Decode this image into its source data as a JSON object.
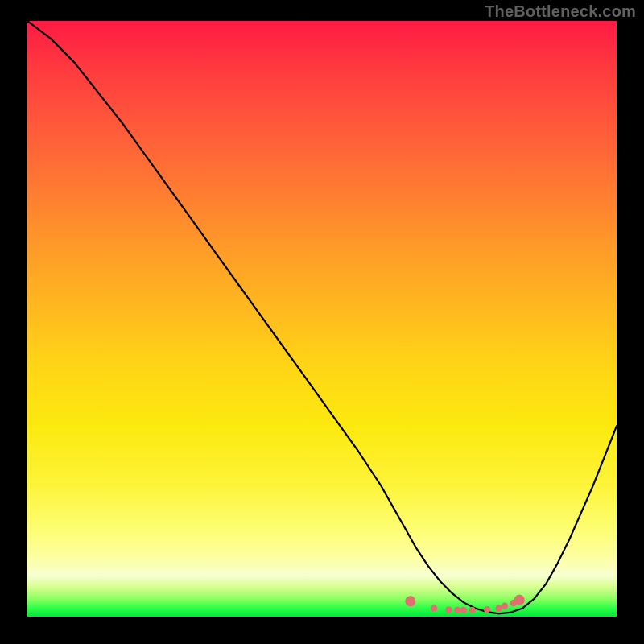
{
  "watermark": "TheBottleneck.com",
  "chart_data": {
    "type": "line",
    "title": "",
    "xlabel": "",
    "ylabel": "",
    "xlim": [
      0,
      100
    ],
    "ylim": [
      0,
      100
    ],
    "series": [
      {
        "name": "bottleneck-curve",
        "x": [
          0,
          4,
          8,
          12,
          16,
          20,
          24,
          28,
          32,
          36,
          40,
          44,
          48,
          52,
          56,
          60,
          62,
          64,
          66,
          68,
          70,
          72,
          74,
          76,
          78,
          80,
          82,
          84,
          86,
          88,
          90,
          92,
          94,
          96,
          98,
          100
        ],
        "values": [
          100,
          97,
          93,
          88,
          83,
          77.5,
          72,
          66.5,
          61,
          55.5,
          50,
          44.5,
          39,
          33.5,
          28,
          22,
          18.5,
          15,
          11.5,
          8.5,
          6,
          4,
          2.4,
          1.4,
          0.8,
          0.5,
          0.7,
          1.4,
          3,
          5.5,
          9,
          13,
          17.5,
          22,
          27,
          32
        ]
      },
      {
        "name": "highlight-dots",
        "x": [
          65,
          69,
          71.5,
          73,
          74,
          75.5,
          78,
          80,
          81,
          82.5,
          83.5
        ],
        "values": [
          2.6,
          1.4,
          1.15,
          1.1,
          1.1,
          1.1,
          1.2,
          1.4,
          1.8,
          2.3,
          2.8
        ]
      }
    ],
    "gradient_colors": [
      "#ff1a44",
      "#ffd516",
      "#fdfd70",
      "#00e83c"
    ]
  }
}
